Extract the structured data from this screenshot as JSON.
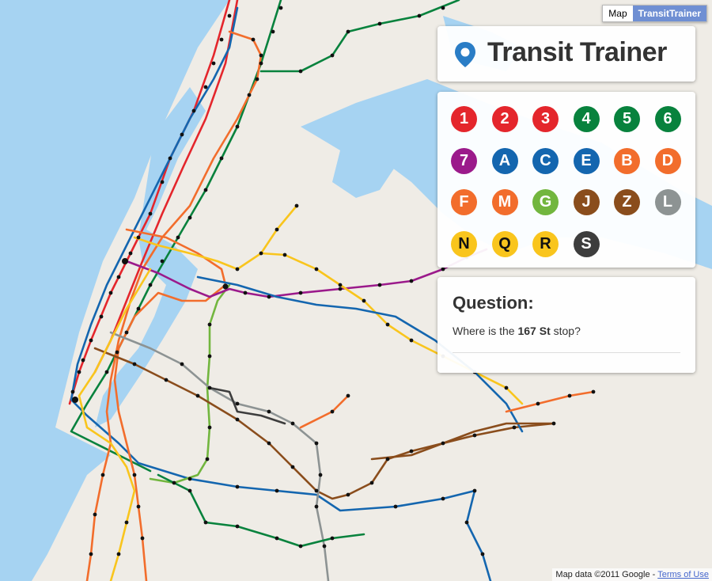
{
  "app": {
    "title": "Transit Trainer"
  },
  "map_type": {
    "map_label": "Map",
    "active_label": "TransitTrainer"
  },
  "colors": {
    "water": "#a6d3f2",
    "land": "#efece6",
    "accent": "#2a7dc6"
  },
  "lines": [
    {
      "label": "1",
      "color": "#e4262c"
    },
    {
      "label": "2",
      "color": "#e4262c"
    },
    {
      "label": "3",
      "color": "#e4262c"
    },
    {
      "label": "4",
      "color": "#08823d"
    },
    {
      "label": "5",
      "color": "#08823d"
    },
    {
      "label": "6",
      "color": "#08823d"
    },
    {
      "label": "7",
      "color": "#9b1a8b"
    },
    {
      "label": "A",
      "color": "#1466af"
    },
    {
      "label": "C",
      "color": "#1466af"
    },
    {
      "label": "E",
      "color": "#1466af"
    },
    {
      "label": "B",
      "color": "#f26d2c"
    },
    {
      "label": "D",
      "color": "#f26d2c"
    },
    {
      "label": "F",
      "color": "#f26d2c"
    },
    {
      "label": "M",
      "color": "#f26d2c"
    },
    {
      "label": "G",
      "color": "#72b63e"
    },
    {
      "label": "J",
      "color": "#8a4d1c"
    },
    {
      "label": "Z",
      "color": "#8a4d1c"
    },
    {
      "label": "L",
      "color": "#8d9393"
    },
    {
      "label": "N",
      "color": "#f9c51d"
    },
    {
      "label": "Q",
      "color": "#f9c51d"
    },
    {
      "label": "R",
      "color": "#f9c51d"
    },
    {
      "label": "S",
      "color": "#3d3d3d"
    }
  ],
  "question": {
    "heading": "Question:",
    "prefix": "Where is the ",
    "stop": "167 St",
    "suffix": " stop?"
  },
  "footer": {
    "map_data": "Map data ©2011 Google - ",
    "terms": "Terms of Use"
  }
}
